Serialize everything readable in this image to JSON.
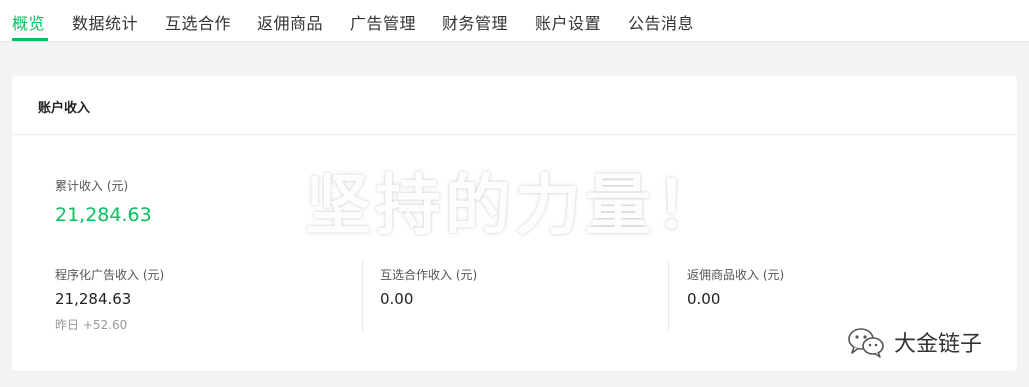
{
  "nav": {
    "tabs": [
      {
        "label": "概览"
      },
      {
        "label": "数据统计"
      },
      {
        "label": "互选合作"
      },
      {
        "label": "返佣商品"
      },
      {
        "label": "广告管理"
      },
      {
        "label": "财务管理"
      },
      {
        "label": "账户设置"
      },
      {
        "label": "公告消息"
      }
    ],
    "active_color": "#07c160"
  },
  "income_card": {
    "title": "账户收入",
    "total": {
      "label": "累计收入 (元)",
      "value": "21,284.63"
    },
    "items": [
      {
        "label": "程序化广告收入 (元)",
        "value": "21,284.63",
        "yesterday": "昨日 +52.60"
      },
      {
        "label": "互选合作收入 (元)",
        "value": "0.00"
      },
      {
        "label": "返佣商品收入 (元)",
        "value": "0.00"
      }
    ]
  },
  "watermark": {
    "text": "坚持的力量！"
  },
  "brand": {
    "name": "大金链子",
    "icon": "wechat-icon"
  }
}
